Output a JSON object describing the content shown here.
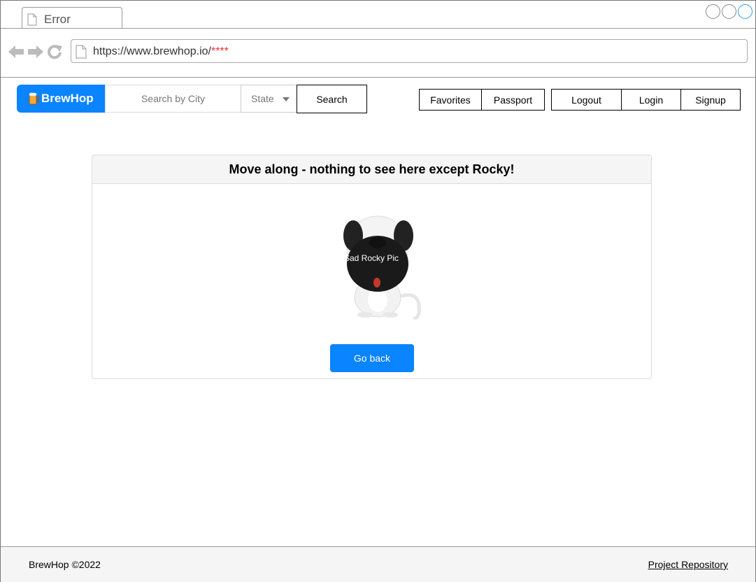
{
  "browser": {
    "tab_title": "Error",
    "url_base": "https://www.brewhop.io/",
    "url_masked": "****"
  },
  "navbar": {
    "brand": "BrewHop",
    "city_placeholder": "Search by City",
    "state_label": "State",
    "search_label": "Search",
    "favorites_label": "Favorites",
    "passport_label": "Passport",
    "logout_label": "Logout",
    "login_label": "Login",
    "signup_label": "Signup"
  },
  "card": {
    "title": "Move along - nothing to see here except Rocky!",
    "image_label": "Sad Rocky Pic",
    "button_label": "Go back"
  },
  "footer": {
    "copyright": "BrewHop ©2022",
    "repo_link": "Project Repository"
  },
  "colors": {
    "accent": "#0a84ff"
  }
}
